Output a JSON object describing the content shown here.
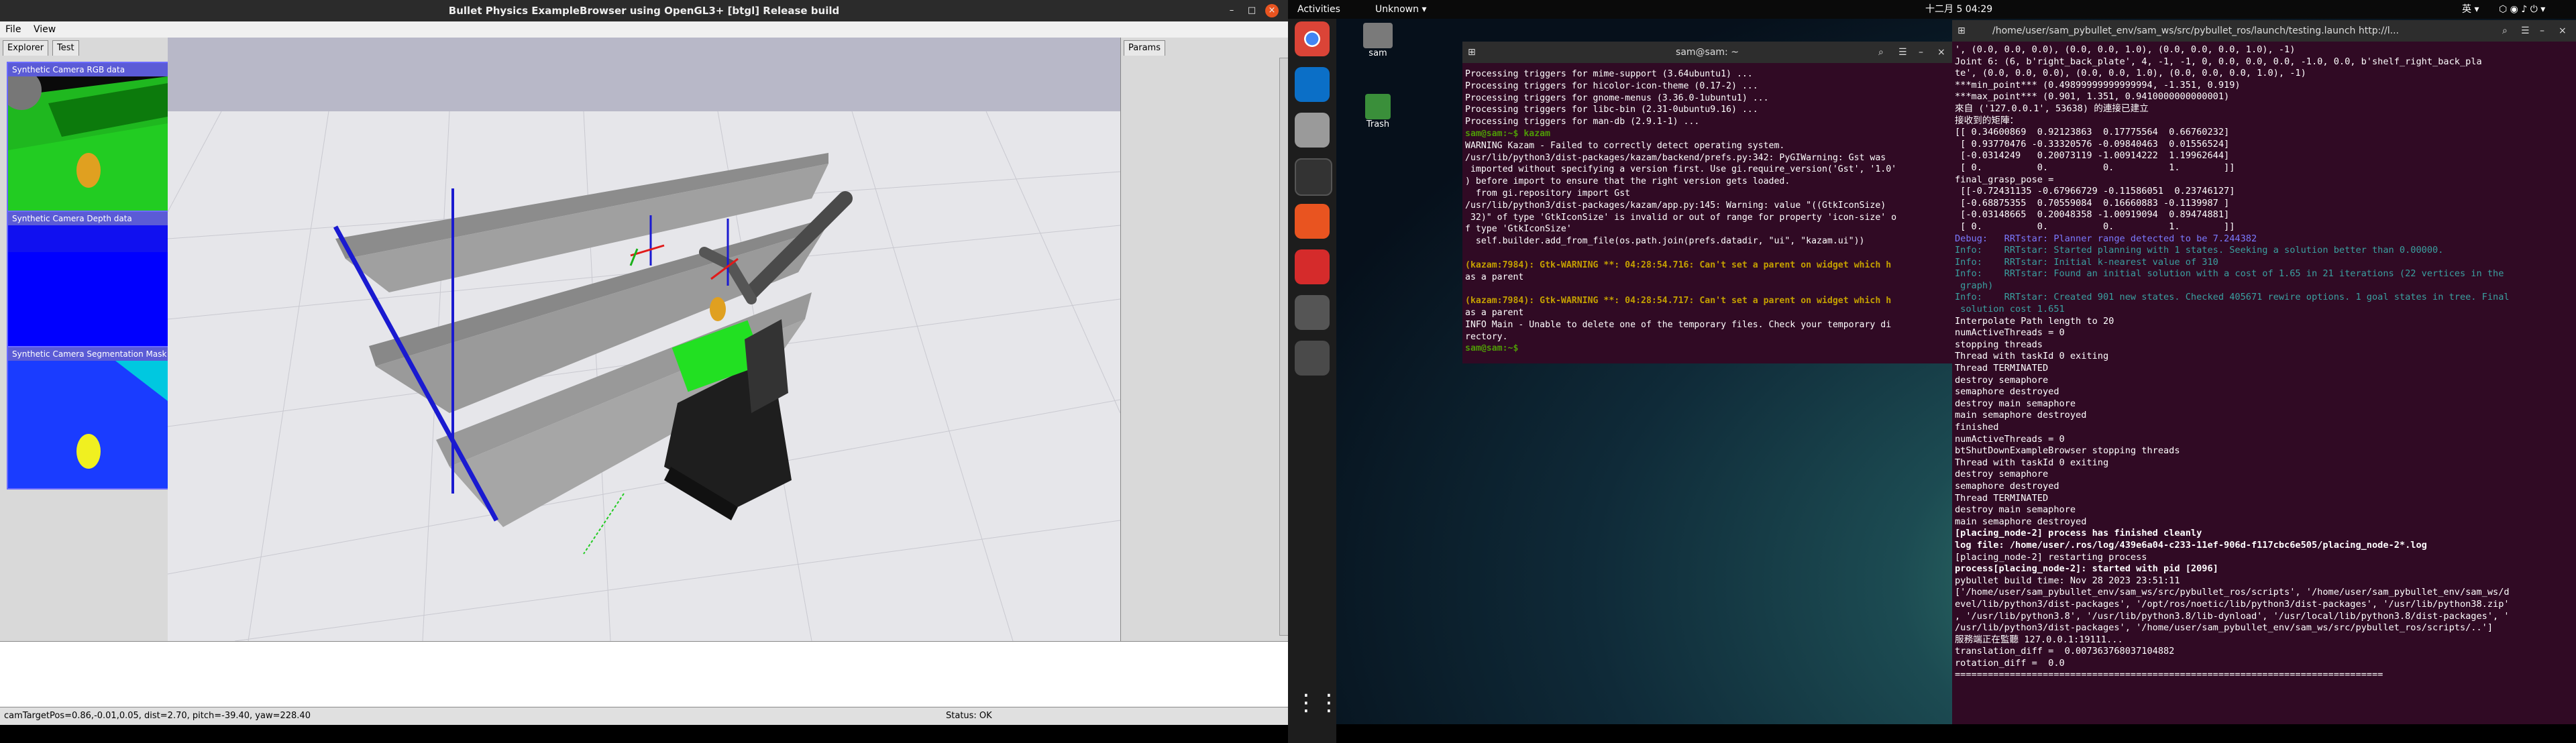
{
  "bullet_window": {
    "title": "Bullet Physics ExampleBrowser using OpenGL3+ [btgl] Release build",
    "menu": [
      "File",
      "View"
    ],
    "left_tabs": [
      "Explorer",
      "Test"
    ],
    "right_tab": "Params",
    "cameras": [
      {
        "title": "Synthetic Camera RGB data"
      },
      {
        "title": "Synthetic Camera Depth data"
      },
      {
        "title": "Synthetic Camera Segmentation Mask"
      }
    ],
    "status_left": "camTargetPos=0.86,-0.01,0.05, dist=2.70, pitch=-39.40, yaw=228.40",
    "status_right": "Status: OK",
    "window_buttons": [
      "–",
      "□",
      "×"
    ]
  },
  "topbar": {
    "activities": "Activities",
    "app_menu": "Unknown",
    "clock": "十二月 5 04:29",
    "keyboard": "英",
    "colors": {
      "bg": "#0a0a0a"
    }
  },
  "dock": {
    "items": [
      "chrome-icon",
      "vscode-icon",
      "files-icon",
      "terminal-icon",
      "app-center-icon",
      "rdp-icon",
      "usb-icon",
      "apps-grid-icon"
    ]
  },
  "desktop_icons": [
    {
      "label": "sam"
    },
    {
      "label": "Trash"
    }
  ],
  "terminal1": {
    "title": "sam@sam: ~",
    "lines": [
      "Processing triggers for mime-support (3.64ubuntu1) ...",
      "Processing triggers for hicolor-icon-theme (0.17-2) ...",
      "Processing triggers for gnome-menus (3.36.0-1ubuntu1) ...",
      "Processing triggers for libc-bin (2.31-0ubuntu9.16) ...",
      "Processing triggers for man-db (2.9.1-1) ...",
      "sam@sam:~$ kazam",
      "WARNING Kazam - Failed to correctly detect operating system.",
      "/usr/lib/python3/dist-packages/kazam/backend/prefs.py:342: PyGIWarning: Gst was",
      " imported without specifying a version first. Use gi.require_version('Gst', '1.0'",
      ") before import to ensure that the right version gets loaded.",
      "  from gi.repository import Gst",
      "/usr/lib/python3/dist-packages/kazam/app.py:145: Warning: value \"((GtkIconSize)",
      " 32)\" of type 'GtkIconSize' is invalid or out of range for property 'icon-size' o",
      "f type 'GtkIconSize'",
      "  self.builder.add_from_file(os.path.join(prefs.datadir, \"ui\", \"kazam.ui\"))",
      "",
      "(kazam:7984): Gtk-WARNING **: 04:28:54.716: Can't set a parent on widget which h",
      "as a parent",
      "",
      "(kazam:7984): Gtk-WARNING **: 04:28:54.717: Can't set a parent on widget which h",
      "as a parent",
      "INFO Main - Unable to delete one of the temporary files. Check your temporary di",
      "rectory.",
      "sam@sam:~$ "
    ]
  },
  "terminal2": {
    "title": "/home/user/sam_pybullet_env/sam_ws/src/pybullet_ros/launch/testing.launch http://l...",
    "lines": [
      "', (0.0, 0.0, 0.0), (0.0, 0.0, 1.0), (0.0, 0.0, 0.0, 1.0), -1)",
      "Joint 6: (6, b'right_back_plate', 4, -1, -1, 0, 0.0, 0.0, 0.0, -1.0, 0.0, b'shelf_right_back_pla",
      "te', (0.0, 0.0, 0.0), (0.0, 0.0, 1.0), (0.0, 0.0, 0.0, 1.0), -1)",
      "***min_point*** (0.49899999999999994, -1.351, 0.919)",
      "***max_point*** (0.901, 1.351, 0.9410000000000001)",
      "來自 ('127.0.0.1', 53638) 的連接已建立",
      "接收到的矩陣：",
      "[[ 0.34600869  0.92123863  0.17775564  0.66760232]",
      " [ 0.93770476 -0.33320576 -0.09840463  0.01556524]",
      " [-0.0314249   0.20073119 -1.00914222  1.19962644]",
      " [ 0.          0.          0.          1.        ]]",
      "final_grasp_pose =",
      " [[-0.72431135 -0.67966729 -0.11586051  0.23746127]",
      " [-0.68875355  0.70559084  0.16660883 -0.1139987 ]",
      " [-0.03148665  0.20048358 -1.00919094  0.89474881]",
      " [ 0.          0.          0.          1.        ]]",
      "Debug:   RRTstar: Planner range detected to be 7.244382",
      "Info:    RRTstar: Started planning with 1 states. Seeking a solution better than 0.00000.",
      "Info:    RRTstar: Initial k-nearest value of 310",
      "Info:    RRTstar: Found an initial solution with a cost of 1.65 in 21 iterations (22 vertices in the",
      " graph)",
      "Info:    RRTstar: Created 901 new states. Checked 405671 rewire options. 1 goal states in tree. Final",
      " solution cost 1.651",
      "Interpolate Path length to 20",
      "numActiveThreads = 0",
      "stopping threads",
      "Thread with taskId 0 exiting",
      "Thread TERMINATED",
      "destroy semaphore",
      "semaphore destroyed",
      "destroy main semaphore",
      "main semaphore destroyed",
      "finished",
      "numActiveThreads = 0",
      "btShutDownExampleBrowser stopping threads",
      "Thread with taskId 0 exiting",
      "destroy semaphore",
      "semaphore destroyed",
      "Thread TERMINATED",
      "destroy main semaphore",
      "main semaphore destroyed",
      "[placing_node-2] process has finished cleanly",
      "log file: /home/user/.ros/log/439e6a04-c233-11ef-906d-f117cbc6e505/placing_node-2*.log",
      "[placing_node-2] restarting process",
      "process[placing_node-2]: started with pid [2096]",
      "pybullet build time: Nov 28 2023 23:51:11",
      "['/home/user/sam_pybullet_env/sam_ws/src/pybullet_ros/scripts', '/home/user/sam_pybullet_env/sam_ws/d",
      "evel/lib/python3/dist-packages', '/opt/ros/noetic/lib/python3/dist-packages', '/usr/lib/python38.zip'",
      ", '/usr/lib/python3.8', '/usr/lib/python3.8/lib-dynload', '/usr/local/lib/python3.8/dist-packages', '",
      "/usr/lib/python3/dist-packages', '/home/user/sam_pybullet_env/sam_ws/src/pybullet_ros/scripts/..']",
      "服務端正在監聽 127.0.0.1:19111...",
      "translation_diff =  0.007363768037104882",
      "rotation_diff =  0.0",
      "==============================================================================",
      ""
    ]
  }
}
